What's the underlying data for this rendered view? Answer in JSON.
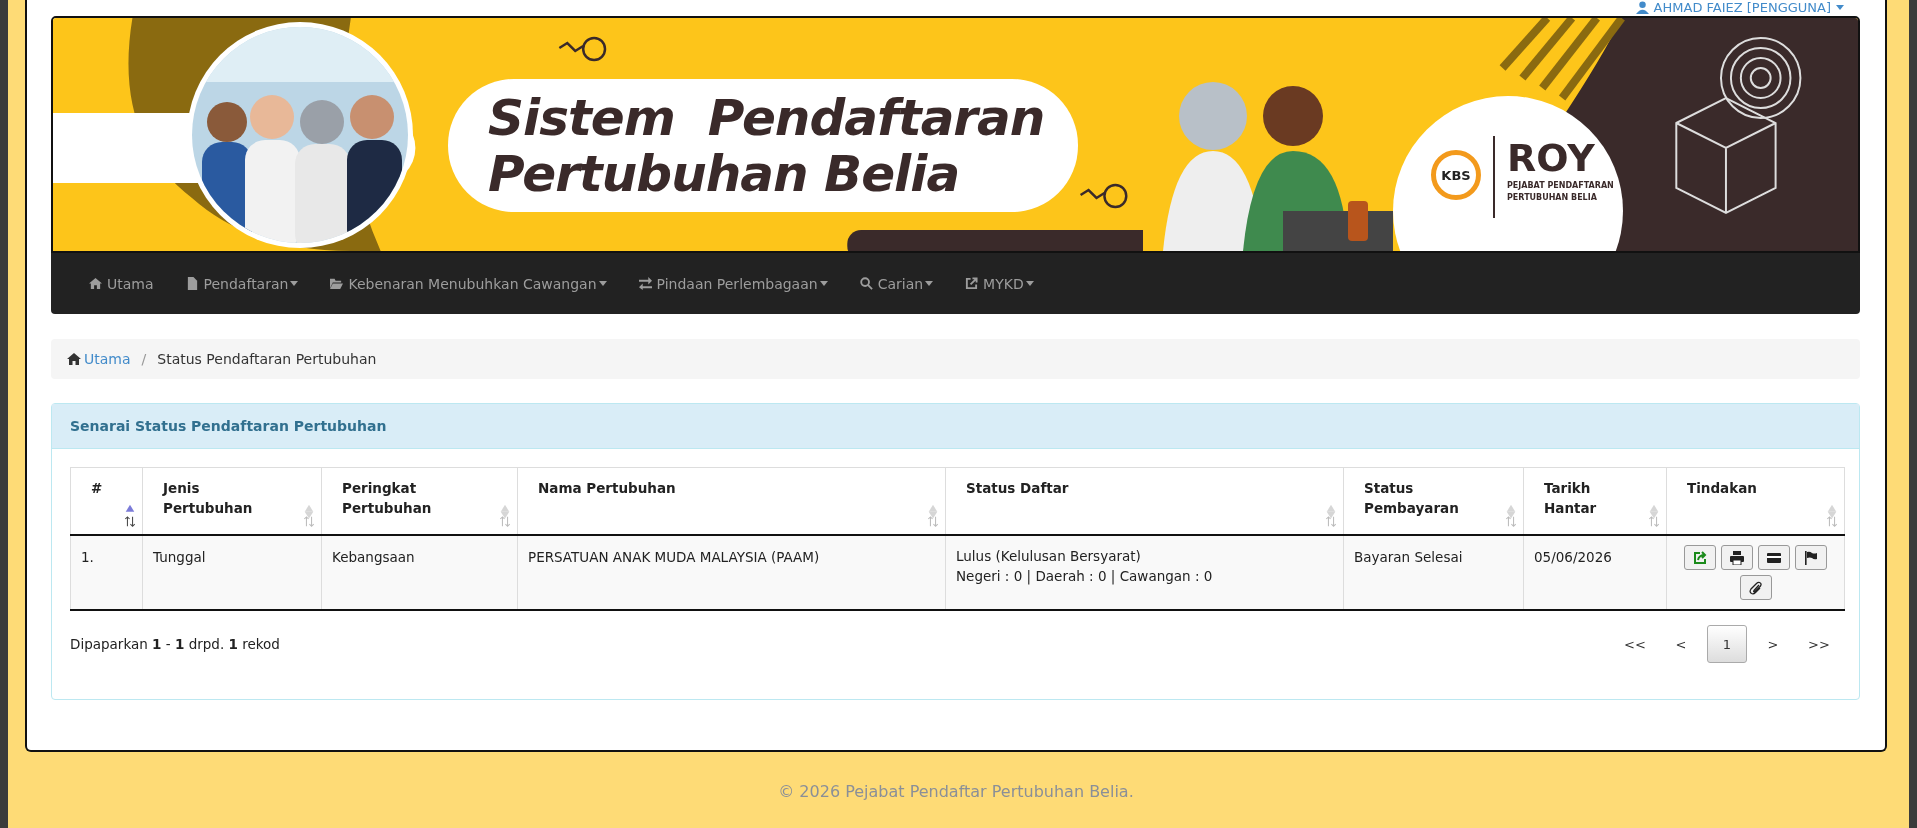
{
  "user_menu": {
    "label": "AHMAD FAIEZ [PENGGUNA]"
  },
  "banner": {
    "title_lines": [
      "Sistem  Pendaftaran",
      "Pertubuhan Belia"
    ],
    "logo": {
      "badge": "KBS",
      "name": "ROY",
      "subtitle_lines": [
        "PEJABAT PENDAFTARAN",
        "PERTUBUHAN BELIA"
      ]
    }
  },
  "nav": [
    {
      "label": "Utama",
      "dropdown": false
    },
    {
      "label": "Pendaftaran",
      "dropdown": true
    },
    {
      "label": "Kebenaran Menubuhkan Cawangan",
      "dropdown": true
    },
    {
      "label": "Pindaan Perlembagaan",
      "dropdown": true
    },
    {
      "label": "Carian",
      "dropdown": true
    },
    {
      "label": "MYKD",
      "dropdown": true
    }
  ],
  "breadcrumb": {
    "separator": "/",
    "items": [
      {
        "label": "Utama",
        "kind": "link"
      },
      {
        "label": "Status Pendaftaran Pertubuhan",
        "kind": "current"
      }
    ]
  },
  "panel": {
    "title": "Senarai Status Pendaftaran Pertubuhan",
    "table": {
      "columns": [
        {
          "label": "#",
          "sorted": true
        },
        {
          "label": "Jenis Pertubuhan",
          "sorted": false
        },
        {
          "label": "Peringkat Pertubuhan",
          "sorted": false
        },
        {
          "label": "Nama Pertubuhan",
          "sorted": false
        },
        {
          "label": "Status Daftar",
          "sorted": false
        },
        {
          "label": "Status Pembayaran",
          "sorted": false
        },
        {
          "label": "Tarikh Hantar",
          "sorted": false
        },
        {
          "label": "Tindakan",
          "sorted": false
        }
      ],
      "rows": [
        {
          "number": "1.",
          "type": "Tunggal",
          "level": "Kebangsaan",
          "name": "PERSATUAN ANAK MUDA MALAYSIA (PAAM)",
          "status_lines": [
            "Lulus (Kelulusan Bersyarat)",
            "Negeri : 0 | Daerah : 0 | Cawangan : 0"
          ],
          "payment": "Bayaran Selesai",
          "date": "05/06/2026"
        }
      ]
    },
    "summary": "Dipaparkan **1** - **1** drpd. **1** rekod",
    "pagination": [
      {
        "label": "<<",
        "selected": false
      },
      {
        "label": "<",
        "selected": false
      },
      {
        "label": "1",
        "selected": true
      },
      {
        "label": ">",
        "selected": false
      },
      {
        "label": ">>",
        "selected": false
      }
    ]
  },
  "footer": "© 2026 Pejabat Pendaftar Pertubuhan Belia."
}
